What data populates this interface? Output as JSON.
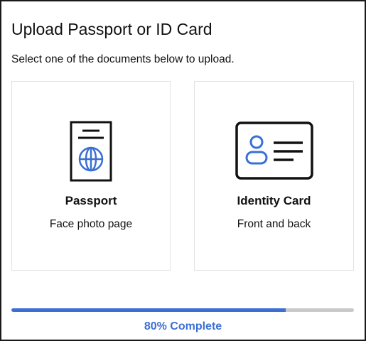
{
  "header": {
    "title": "Upload Passport or ID Card",
    "subtitle": "Select one of the documents below to upload."
  },
  "documents": [
    {
      "title": "Passport",
      "description": "Face photo page",
      "icon": "passport-icon"
    },
    {
      "title": "Identity Card",
      "description": "Front and back",
      "icon": "id-card-icon"
    }
  ],
  "progress": {
    "percent": 80,
    "label": "80% Complete"
  },
  "colors": {
    "accent": "#3b6fd4",
    "track": "#c9c9c9",
    "text": "#111111",
    "card_border": "#e2e2e2"
  }
}
